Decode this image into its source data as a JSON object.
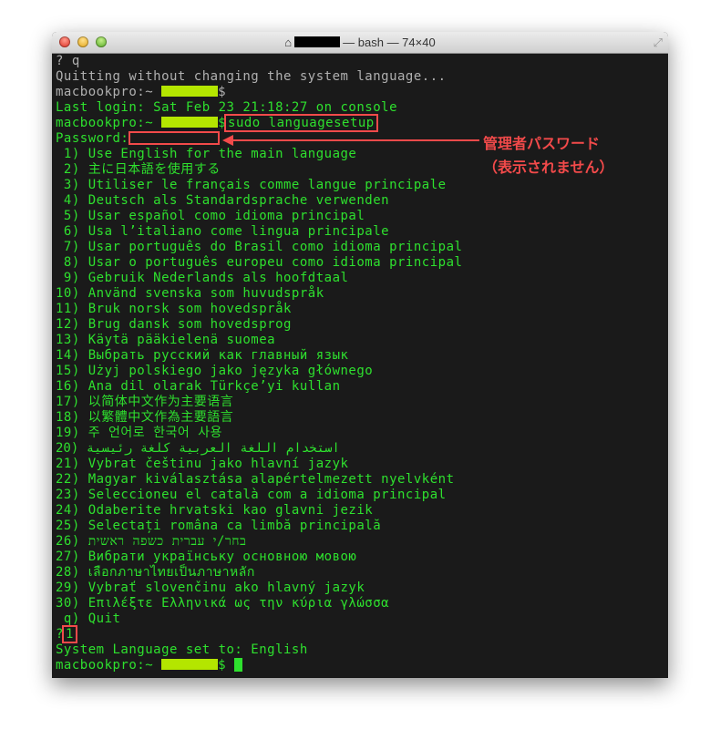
{
  "window": {
    "title_host_redacted": true,
    "title": "— bash — 74×40",
    "home_icon": "house-icon",
    "resize_icon": "fullscreen-icon"
  },
  "terminal": {
    "lines": [
      [
        {
          "k": "g",
          "t": "? q"
        }
      ],
      [
        {
          "k": "g",
          "t": "Quitting without changing the system language..."
        }
      ],
      [
        {
          "k": "g",
          "t": "macbookpro:~ "
        },
        {
          "k": "r"
        },
        {
          "k": "g",
          "t": "$"
        }
      ],
      [
        {
          "t": "Last login: Sat Feb 23 21:18:27 on console"
        }
      ],
      [
        {
          "t": "macbookpro:~ "
        },
        {
          "k": "r"
        },
        {
          "t": "$"
        },
        {
          "k": "box",
          "t": "sudo languagesetup"
        }
      ],
      [
        {
          "t": "Password:"
        },
        {
          "k": "blank"
        }
      ],
      [
        {
          "t": " 1) Use English for the main language"
        }
      ],
      [
        {
          "t": " 2) 主に日本語を使用する"
        }
      ],
      [
        {
          "t": " 3) Utiliser le français comme langue principale"
        }
      ],
      [
        {
          "t": " 4) Deutsch als Standardsprache verwenden"
        }
      ],
      [
        {
          "t": " 5) Usar español como idioma principal"
        }
      ],
      [
        {
          "t": " 6) Usa l’italiano come lingua principale"
        }
      ],
      [
        {
          "t": " 7) Usar português do Brasil como idioma principal"
        }
      ],
      [
        {
          "t": " 8) Usar o português europeu como idioma principal"
        }
      ],
      [
        {
          "t": " 9) Gebruik Nederlands als hoofdtaal"
        }
      ],
      [
        {
          "t": "10) Använd svenska som huvudspråk"
        }
      ],
      [
        {
          "t": "11) Bruk norsk som hovedspråk"
        }
      ],
      [
        {
          "t": "12) Brug dansk som hovedsprog"
        }
      ],
      [
        {
          "t": "13) Käytä pääkielenä suomea"
        }
      ],
      [
        {
          "t": "14) Выбрать русский как главный язык"
        }
      ],
      [
        {
          "t": "15) Użyj polskiego jako języka głównego"
        }
      ],
      [
        {
          "t": "16) Ana dil olarak Türkçe’yi kullan"
        }
      ],
      [
        {
          "t": "17) 以简体中文作为主要语言"
        }
      ],
      [
        {
          "t": "18) 以繁體中文作為主要語言"
        }
      ],
      [
        {
          "t": "19) 주 언어로 한국어 사용"
        }
      ],
      [
        {
          "t": "استخدام اللغة العربية كلغة رئيسية (20"
        }
      ],
      [
        {
          "t": "21) Vybrat češtinu jako hlavní jazyk"
        }
      ],
      [
        {
          "t": "22) Magyar kiválasztása alapértelmezett nyelvként"
        }
      ],
      [
        {
          "t": "23) Seleccioneu el català com a idioma principal"
        }
      ],
      [
        {
          "t": "24) Odaberite hrvatski kao glavni jezik"
        }
      ],
      [
        {
          "t": "25) Selectați româna ca limbă principală"
        }
      ],
      [
        {
          "t": "בחר/י עברית כשפה ראשית (26"
        }
      ],
      [
        {
          "t": "27) Вибрати українську основною мовою"
        }
      ],
      [
        {
          "t": "28) เลือกภาษาไทยเป็นภาษาหลัก"
        }
      ],
      [
        {
          "t": "29) Vybrať slovenčinu ako hlavný jazyk"
        }
      ],
      [
        {
          "t": "30) Επιλέξτε Ελληνικά ως την κύρια γλώσσα"
        }
      ],
      [
        {
          "t": " q) Quit"
        }
      ],
      [
        {
          "t": "?"
        },
        {
          "k": "box",
          "t": "1"
        }
      ],
      [
        {
          "t": "System Language set to: English"
        }
      ],
      [
        {
          "t": "macbookpro:~ "
        },
        {
          "k": "r"
        },
        {
          "t": "$ "
        },
        {
          "k": "cursor"
        }
      ]
    ]
  },
  "annotation": {
    "line1": "管理者パスワード",
    "line2": "（表示されません）"
  },
  "colors": {
    "text": "#2ee02e",
    "old_text": "#b0b0b0",
    "highlight": "#f24a4a",
    "redaction": "#b4e600"
  }
}
